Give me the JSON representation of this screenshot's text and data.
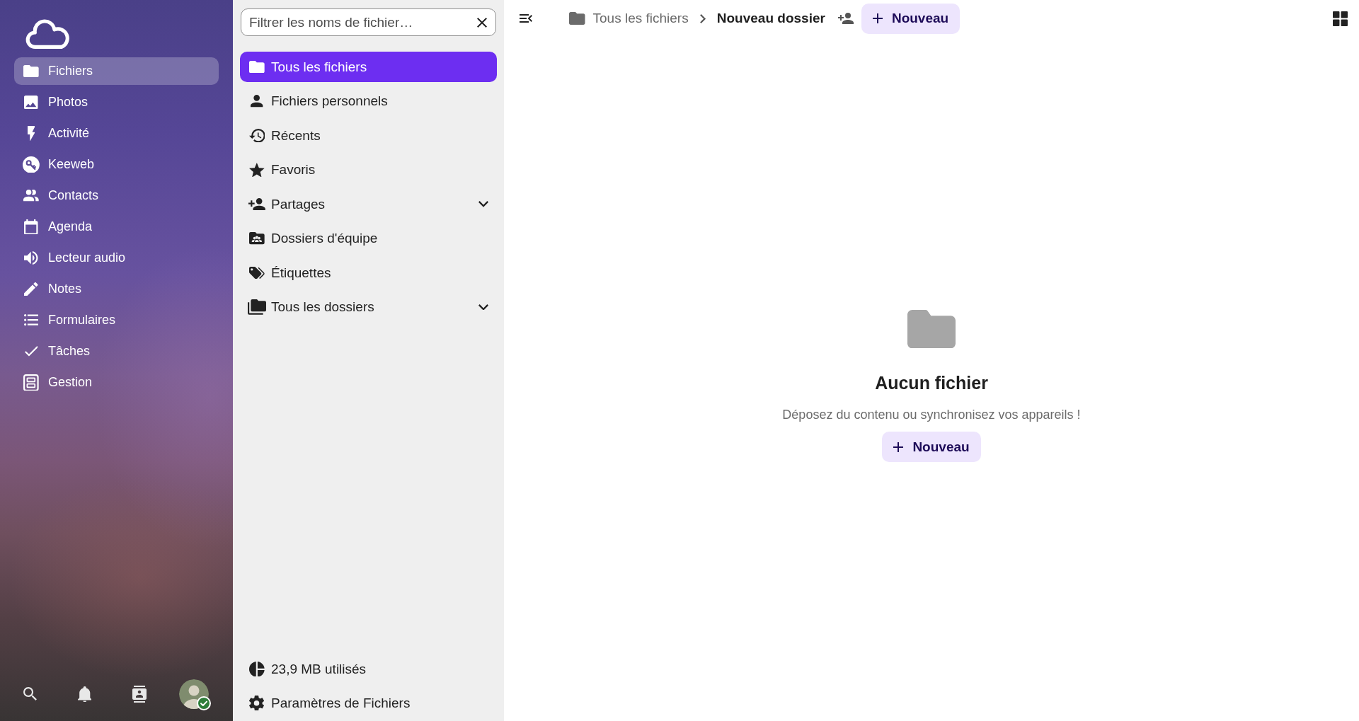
{
  "app_menu": {
    "items": [
      {
        "label": "Fichiers",
        "selected": true
      },
      {
        "label": "Photos",
        "selected": false
      },
      {
        "label": "Activité",
        "selected": false
      },
      {
        "label": "Keeweb",
        "selected": false
      },
      {
        "label": "Contacts",
        "selected": false
      },
      {
        "label": "Agenda",
        "selected": false
      },
      {
        "label": "Lecteur audio",
        "selected": false
      },
      {
        "label": "Notes",
        "selected": false
      },
      {
        "label": "Formulaires",
        "selected": false
      },
      {
        "label": "Tâches",
        "selected": false
      },
      {
        "label": "Gestion",
        "selected": false
      }
    ],
    "account": {
      "online": true
    }
  },
  "files_navigation": {
    "filter": {
      "placeholder": "Filtrer les noms de fichier…"
    },
    "items": [
      {
        "label": "Tous les fichiers",
        "selected": true,
        "expandable": false
      },
      {
        "label": "Fichiers personnels",
        "selected": false,
        "expandable": false
      },
      {
        "label": "Récents",
        "selected": false,
        "expandable": false
      },
      {
        "label": "Favoris",
        "selected": false,
        "expandable": false
      },
      {
        "label": "Partages",
        "selected": false,
        "expandable": true
      },
      {
        "label": "Dossiers d'équipe",
        "selected": false,
        "expandable": false
      },
      {
        "label": "Étiquettes",
        "selected": false,
        "expandable": false
      },
      {
        "label": "Tous les dossiers",
        "selected": false,
        "expandable": true
      }
    ],
    "footer": {
      "storage": "23,9 MB utilisés",
      "settings": "Paramètres de Fichiers"
    }
  },
  "toolbar": {
    "breadcrumbs": [
      {
        "label": "Tous les fichiers",
        "current": false
      },
      {
        "label": "Nouveau dossier",
        "current": true
      }
    ],
    "new_button": "Nouveau"
  },
  "empty_state": {
    "title": "Aucun fichier",
    "description": "Déposez du contenu ou synchronisez vos appareils !",
    "button": "Nouveau"
  }
}
